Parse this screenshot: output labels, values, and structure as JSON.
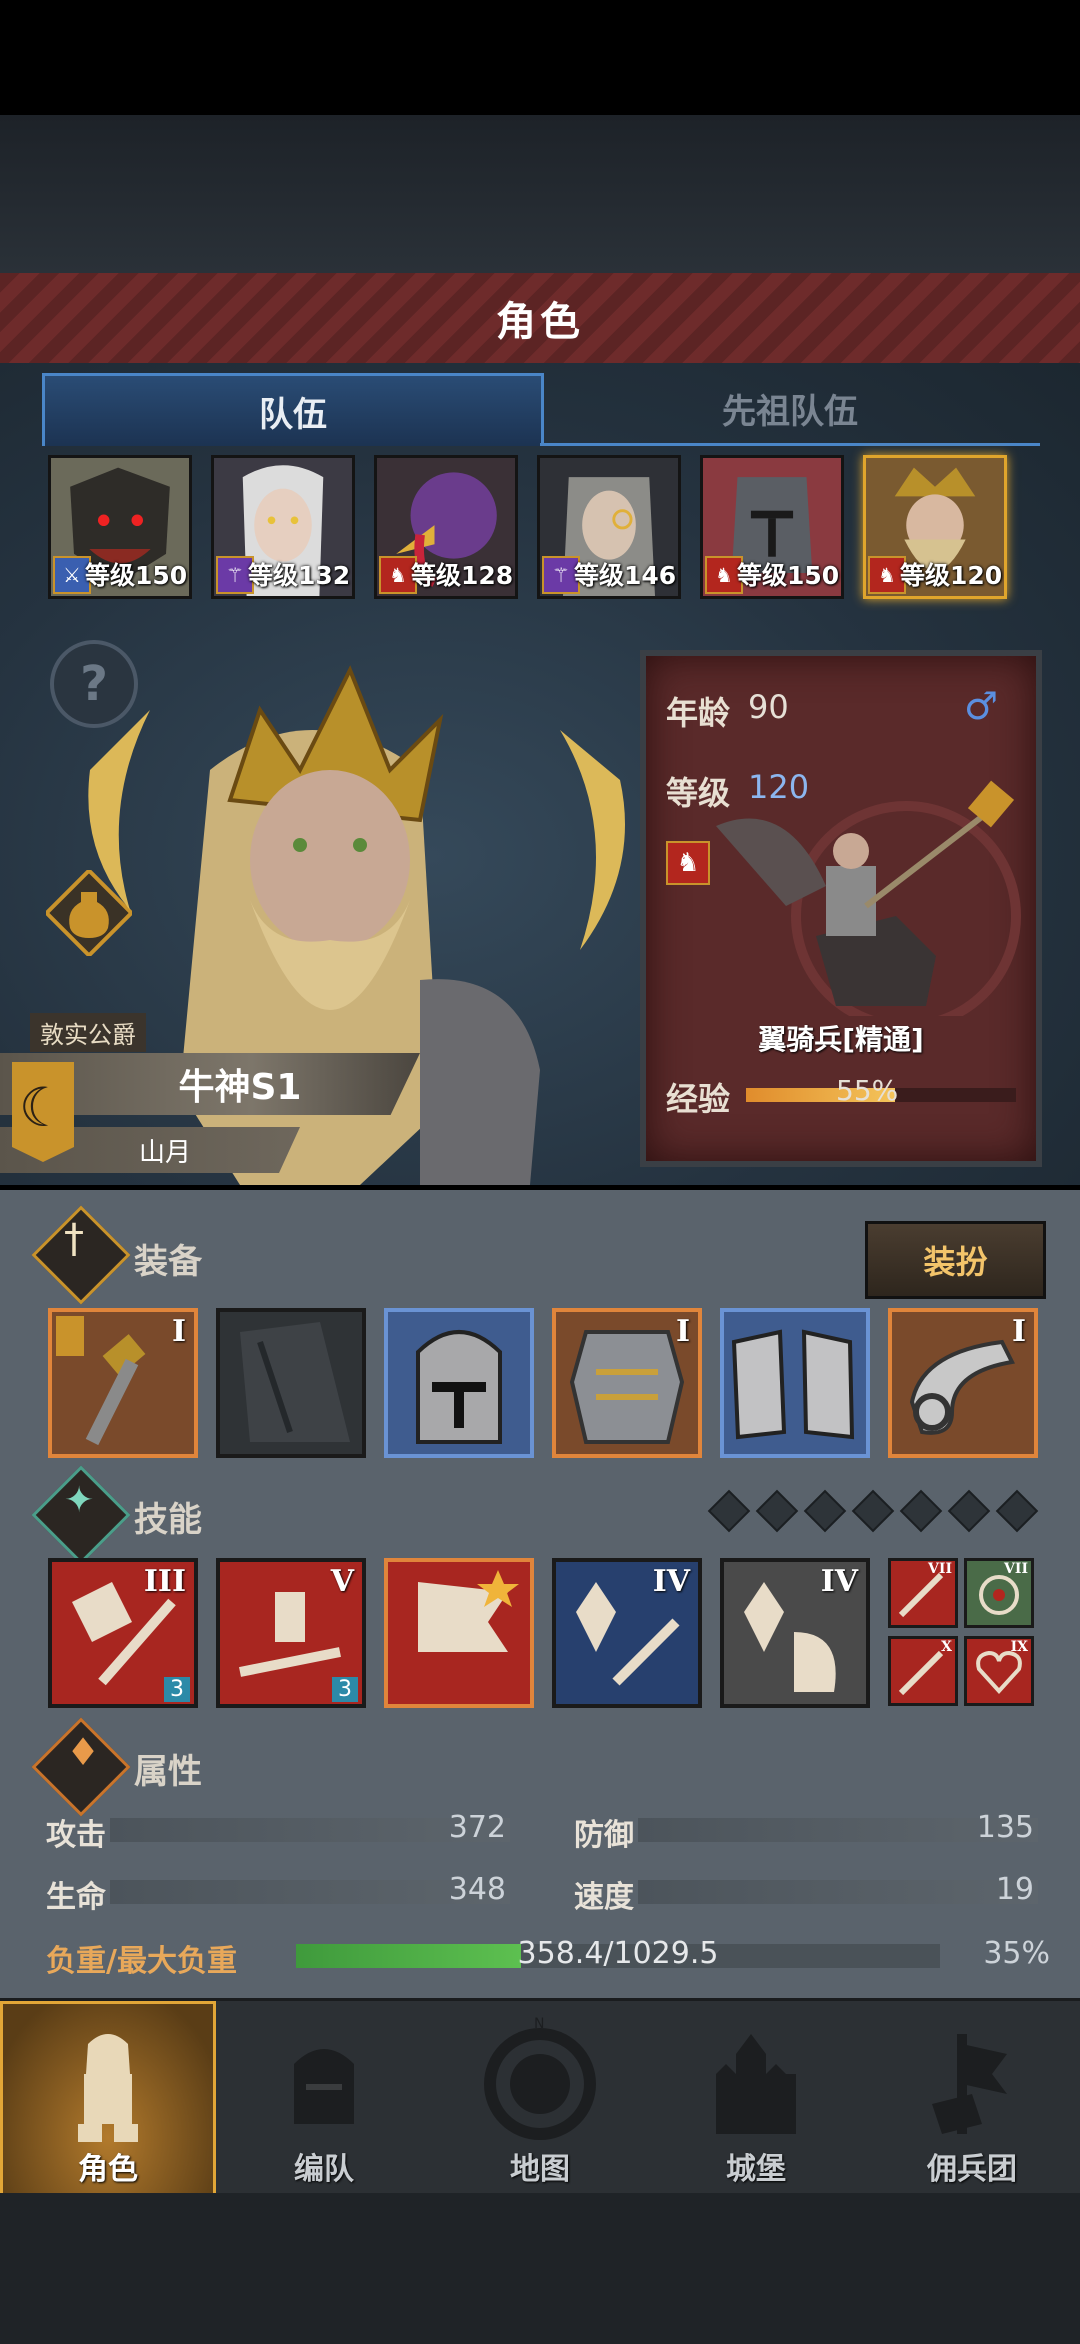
{
  "header": {
    "title": "角色"
  },
  "tabs": [
    {
      "label": "队伍",
      "active": true
    },
    {
      "label": "先祖队伍",
      "active": false
    }
  ],
  "roster": [
    {
      "level": "等级150",
      "class_icon": "sword-icon",
      "class_color": "#3a5fb0"
    },
    {
      "level": "等级132",
      "class_icon": "staff-icon",
      "class_color": "#6b3aa6"
    },
    {
      "level": "等级128",
      "class_icon": "horse-icon",
      "class_color": "#b3261e"
    },
    {
      "level": "等级146",
      "class_icon": "staff-icon",
      "class_color": "#6b3aa6"
    },
    {
      "level": "等级150",
      "class_icon": "horse-icon",
      "class_color": "#b3261e"
    },
    {
      "level": "等级120",
      "class_icon": "horse-icon",
      "class_color": "#b3261e",
      "selected": true
    }
  ],
  "character": {
    "title": "敦实公爵",
    "name": "牛神S1",
    "sub": "山月"
  },
  "info_card": {
    "age_label": "年龄",
    "age_value": "90",
    "gender_icon": "male-icon",
    "level_label": "等级",
    "level_value": "120",
    "unit_name": "翼骑兵[精通]",
    "exp_label": "经验",
    "exp_value": "55%",
    "exp_fraction": 0.55
  },
  "equipment": {
    "label": "装备",
    "dress_button": "装扮",
    "slots": [
      {
        "name": "hammer-weapon-icon",
        "rank": "I",
        "rarity": "orange"
      },
      {
        "name": "cape-icon",
        "rank": "",
        "rarity": "dark"
      },
      {
        "name": "helmet-icon",
        "rank": "",
        "rarity": "blue"
      },
      {
        "name": "armor-icon",
        "rank": "I",
        "rarity": "orange"
      },
      {
        "name": "boots-icon",
        "rank": "",
        "rarity": "blue"
      },
      {
        "name": "horn-icon",
        "rank": "I",
        "rarity": "orange"
      }
    ]
  },
  "skills": {
    "label": "技能",
    "items": [
      {
        "name": "charge-skill-icon",
        "rank": "III",
        "badge": "3"
      },
      {
        "name": "rally-skill-icon",
        "rank": "V",
        "badge": "3"
      },
      {
        "name": "banner-skill-icon",
        "rank": "",
        "badge": ""
      },
      {
        "name": "crystal-sword-skill-icon",
        "rank": "IV",
        "badge": ""
      },
      {
        "name": "crystal-shield-skill-icon",
        "rank": "IV",
        "badge": ""
      }
    ],
    "mini": [
      {
        "name": "sword-mini-icon",
        "rank": "VII"
      },
      {
        "name": "target-mini-icon",
        "rank": "VII"
      },
      {
        "name": "sword-mini-icon",
        "rank": "X"
      },
      {
        "name": "heart-mini-icon",
        "rank": "IX"
      }
    ]
  },
  "attributes": {
    "label": "属性",
    "attack_label": "攻击",
    "attack_value": "372",
    "defense_label": "防御",
    "defense_value": "135",
    "hp_label": "生命",
    "hp_value": "348",
    "speed_label": "速度",
    "speed_value": "19",
    "load_label": "负重/最大负重",
    "load_value": "358.4/1029.5",
    "load_percent": "35%",
    "load_fraction": 0.35
  },
  "nav": [
    {
      "label": "角色",
      "active": true
    },
    {
      "label": "编队",
      "active": false
    },
    {
      "label": "地图",
      "active": false
    },
    {
      "label": "城堡",
      "active": false
    },
    {
      "label": "佣兵团",
      "active": false
    }
  ]
}
